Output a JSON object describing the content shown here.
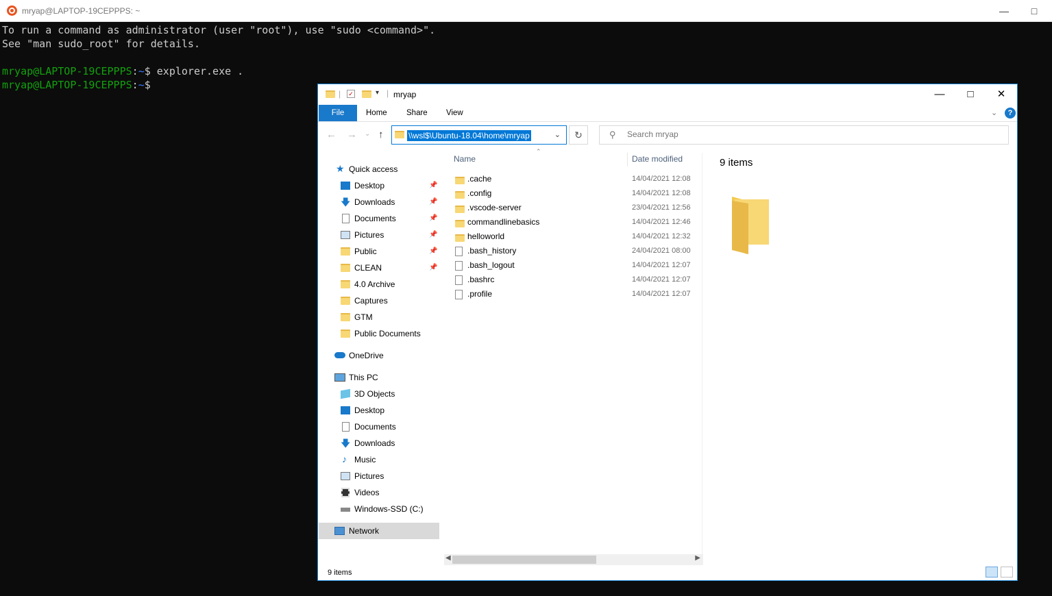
{
  "terminal": {
    "title": "mryap@LAPTOP-19CEPPPS: ~",
    "lines": {
      "l1": "To run a command as administrator (user \"root\"), use \"sudo <command>\".",
      "l2": "See \"man sudo_root\" for details.",
      "prompt_user": "mryap@LAPTOP-19CEPPPS",
      "prompt_path": "~",
      "cmd1": "explorer.exe ."
    },
    "colors": {
      "prompt_user": "#13a10e",
      "prompt_path": "#3b78ff",
      "text": "#cccccc",
      "background": "#0c0c0c"
    }
  },
  "explorer": {
    "title": "mryap",
    "ribbon": {
      "file": "File",
      "home": "Home",
      "share": "Share",
      "view": "View"
    },
    "address": "\\\\wsl$\\Ubuntu-18.04\\home\\mryap",
    "search_placeholder": "Search mryap",
    "columns": {
      "name": "Name",
      "date": "Date modified"
    },
    "nav": {
      "quick_access": "Quick access",
      "qa_items": [
        "Desktop",
        "Downloads",
        "Documents",
        "Pictures",
        "Public",
        "CLEAN",
        "4.0 Archive",
        "Captures",
        "GTM",
        "Public Documents"
      ],
      "onedrive": "OneDrive",
      "this_pc": "This PC",
      "pc_items": [
        "3D Objects",
        "Desktop",
        "Documents",
        "Downloads",
        "Music",
        "Pictures",
        "Videos",
        "Windows-SSD (C:)"
      ],
      "network": "Network"
    },
    "files": [
      {
        "name": ".cache",
        "date": "14/04/2021 12:08",
        "type": "folder"
      },
      {
        "name": ".config",
        "date": "14/04/2021 12:08",
        "type": "folder"
      },
      {
        "name": ".vscode-server",
        "date": "23/04/2021 12:56",
        "type": "folder"
      },
      {
        "name": "commandlinebasics",
        "date": "14/04/2021 12:46",
        "type": "folder"
      },
      {
        "name": "helloworld",
        "date": "14/04/2021 12:32",
        "type": "folder"
      },
      {
        "name": ".bash_history",
        "date": "24/04/2021 08:00",
        "type": "file"
      },
      {
        "name": ".bash_logout",
        "date": "14/04/2021 12:07",
        "type": "file"
      },
      {
        "name": ".bashrc",
        "date": "14/04/2021 12:07",
        "type": "file"
      },
      {
        "name": ".profile",
        "date": "14/04/2021 12:07",
        "type": "file"
      }
    ],
    "preview_count": "9 items",
    "status": "9 items",
    "accent": "#0078d7"
  }
}
